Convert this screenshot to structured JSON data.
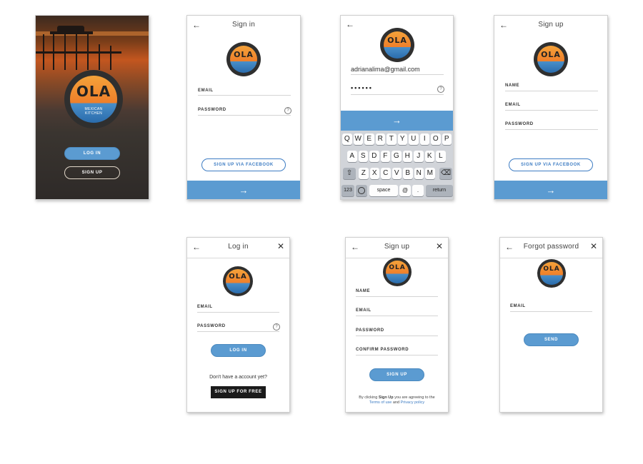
{
  "splash": {
    "login_label": "LOG IN",
    "signup_label": "SIGN UP"
  },
  "logo": {
    "wordmark": "OLA",
    "subtitle_line1": "MEXICAN",
    "subtitle_line2": "KITCHEN"
  },
  "signin_screen": {
    "title": "Sign in",
    "email_label": "EMAIL",
    "password_label": "PASSWORD",
    "facebook_label": "SIGN UP VIA FACEBOOK"
  },
  "signin_filled": {
    "email_value": "adrianalima@gmail.com",
    "password_value": "••••••",
    "keyboard": {
      "row1": [
        "Q",
        "W",
        "E",
        "R",
        "T",
        "Y",
        "U",
        "I",
        "O",
        "P"
      ],
      "row2": [
        "A",
        "S",
        "D",
        "F",
        "G",
        "H",
        "J",
        "K",
        "L"
      ],
      "row3": [
        "Z",
        "X",
        "C",
        "V",
        "B",
        "N",
        "M"
      ],
      "numbers_key": "123",
      "space_key": "space",
      "at_key": "@",
      "dot_key": ".",
      "return_key": "return"
    }
  },
  "signup_screen": {
    "title": "Sign up",
    "name_label": "NAME",
    "email_label": "EMAIL",
    "password_label": "PASSWORD",
    "facebook_label": "SIGN UP VIA FACEBOOK"
  },
  "login_screen": {
    "title": "Log in",
    "email_label": "EMAIL",
    "password_label": "PASSWORD",
    "login_label": "LOG IN",
    "no_account_text": "Don't have a account yet?",
    "signup_free_label": "SIGN UP FOR FREE"
  },
  "signup_full_screen": {
    "title": "Sign up",
    "name_label": "NAME",
    "email_label": "EMAIL",
    "password_label": "PASSWORD",
    "confirm_label": "CONFIRM PASSWORD",
    "signup_label": "SIGN UP",
    "terms_prefix": "By clicking ",
    "terms_bold": "Sign Up",
    "terms_mid": " you are agreeing to the",
    "terms_link": "Terms of use",
    "terms_and": " and ",
    "privacy_link": "Privacy policy"
  },
  "forgot_screen": {
    "title": "Forgot password",
    "email_label": "EMAIL",
    "send_label": "SEND"
  },
  "icons": {
    "back": "←",
    "close": "✕",
    "forward": "→",
    "help": "?",
    "shift": "⇧",
    "backspace": "⌫",
    "globe": "🌐"
  },
  "colors": {
    "accent_blue": "#5b9bd1",
    "link_blue": "#3d7cc3",
    "dark_button": "#1a1a1a",
    "logo_orange": "#ef7f2a"
  }
}
